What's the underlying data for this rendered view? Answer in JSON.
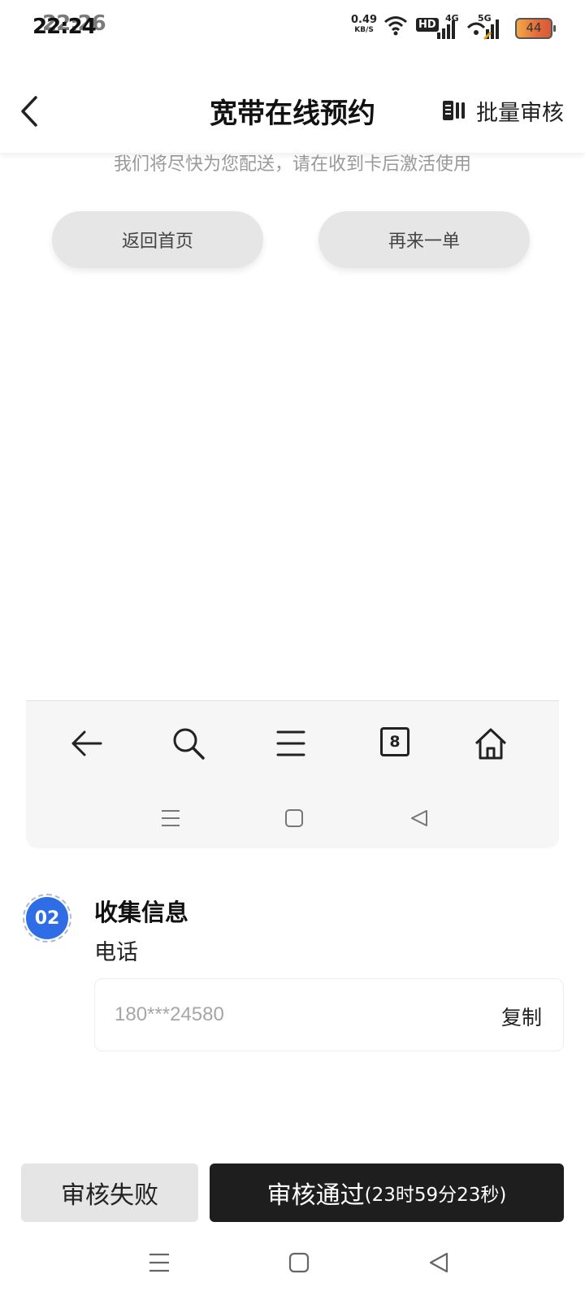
{
  "status_bar": {
    "time": "22:24",
    "time_overlay": "22:26",
    "net_speed": "0.49",
    "net_unit": "KB/S",
    "hd_label": "HD",
    "net_4g": "4G",
    "net_5g": "5G",
    "battery": "44"
  },
  "header": {
    "title": "宽带在线预约",
    "batch_label": "批量审核"
  },
  "notice": "我们将尽快为您配送，请在收到卡后激活使用",
  "buttons": {
    "home": "返回首页",
    "again": "再来一单"
  },
  "embedded_toolbar": {
    "tab_count": "8"
  },
  "section": {
    "step": "02",
    "title": "收集信息",
    "field_label": "电话",
    "phone": "180***24580",
    "copy": "复制"
  },
  "actions": {
    "fail": "审核失败",
    "pass": "审核通过",
    "timer": "(23时59分23秒)"
  },
  "colors": {
    "accent_blue": "#2f6de6",
    "dark_button": "#1e1e1e",
    "light_button": "#e5e5e5"
  }
}
